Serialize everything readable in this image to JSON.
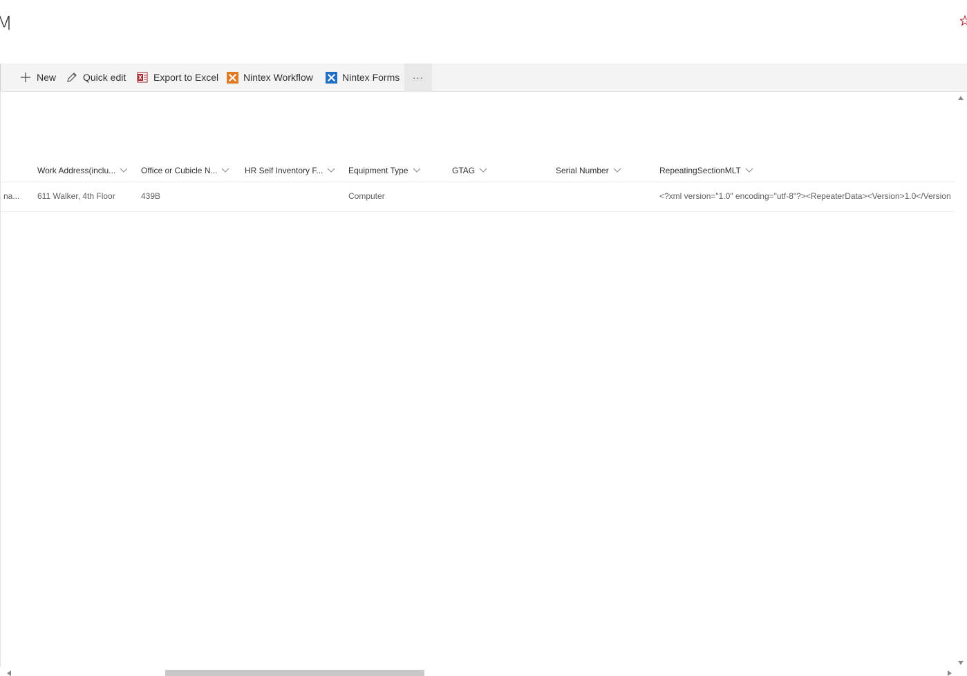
{
  "header": {
    "title_fragment": "M"
  },
  "commandbar": {
    "new_label": "New",
    "quick_edit_label": "Quick edit",
    "export_label": "Export to Excel",
    "workflow_label": "Nintex Workflow",
    "forms_label": "Nintex Forms",
    "more_label": "···"
  },
  "table": {
    "columns": [
      "Work Address(inclu...",
      "Office or Cubicle N...",
      "HR Self Inventory F...",
      "Equipment Type",
      "GTAG",
      "Serial Number",
      "RepeatingSectionMLT"
    ],
    "rows": [
      {
        "truncated_prev": "na...",
        "work_address": "611 Walker, 4th Floor",
        "office": "439B",
        "hr_self_inventory": "",
        "equipment_type": "Computer",
        "gtag": "",
        "serial_number": "",
        "repeating_section": "<?xml version=\"1.0\" encoding=\"utf-8\"?><RepeaterData><Version>1.0</Version"
      }
    ]
  },
  "colors": {
    "accent_blue": "#0078d4",
    "nintex_orange": "#e07b24",
    "nintex_blue": "#1f6fc5",
    "excel_red": "#a4262c"
  }
}
